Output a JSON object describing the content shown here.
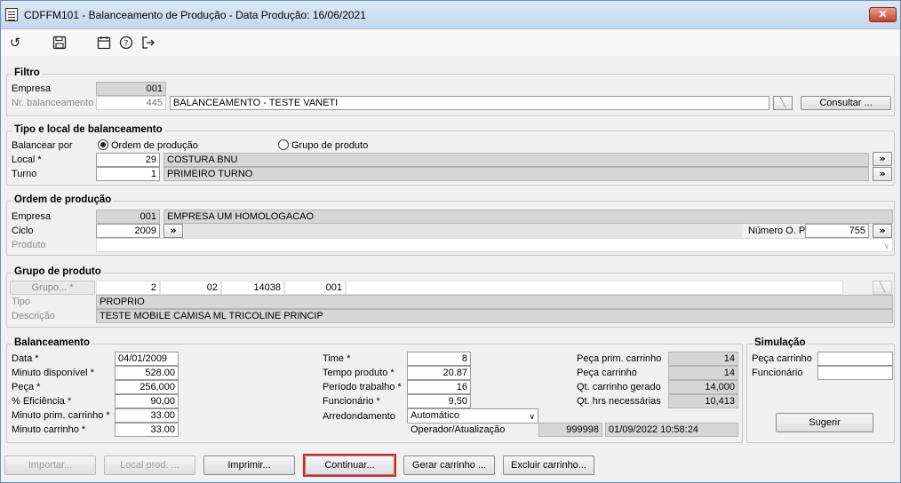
{
  "window": {
    "title": "CDFFM101 - Balanceamento de Produção - Data Produção:  16/06/2021",
    "close_label": "✕"
  },
  "toolbar": {
    "icons": [
      "undo-icon",
      "save-icon",
      "calendar-icon",
      "help-icon",
      "exit-icon"
    ]
  },
  "filtro": {
    "title": "Filtro",
    "empresa_label": "Empresa",
    "empresa_value": "001",
    "nr_label": "Nr. balanceamento",
    "nr_value": "445",
    "nr_desc": "BALANCEAMENTO - TESTE VANETI",
    "consultar_label": "Consultar ..."
  },
  "tipo_local": {
    "title": "Tipo e local de balanceamento",
    "balancear_label": "Balancear por",
    "radio_op": "Ordem de produção",
    "radio_grupo": "Grupo de produto",
    "local_label": "Local *",
    "local_value": "29",
    "local_desc": "COSTURA BNU",
    "turno_label": "Turno",
    "turno_value": "1",
    "turno_desc": "PRIMEIRO TURNO"
  },
  "ordem": {
    "title": "Ordem de produção",
    "empresa_label": "Empresa",
    "empresa_value": "001",
    "empresa_desc": "EMPRESA UM HOMOLOGACAO",
    "ciclo_label": "Ciclo",
    "ciclo_value": "2009",
    "numero_label": "Número O. P.",
    "numero_value": "755",
    "produto_label": "Produto"
  },
  "grupo": {
    "title": "Grupo de produto",
    "grupo_label": "Grupo... *",
    "g1": "2",
    "g2": "02",
    "g3": "14038",
    "g4": "001",
    "tipo_label": "Tipo",
    "tipo_value": "PROPRIO",
    "descricao_label": "Descrição",
    "descricao_value": "TESTE MOBILE CAMISA ML TRICOLINE PRINCIP"
  },
  "balanceamento": {
    "title": "Balanceamento",
    "data_label": "Data *",
    "data_value": "04/01/2009",
    "minuto_disp_label": "Minuto disponível *",
    "minuto_disp_value": "528.00",
    "peca_label": "Peça *",
    "peca_value": "256,000",
    "eficiencia_label": "% Eficiência *",
    "eficiencia_value": "90,00",
    "minuto_prim_label": "Minuto prim. carrinho *",
    "minuto_prim_value": "33.00",
    "minuto_carr_label": "Minuto carrinho *",
    "minuto_carr_value": "33.00",
    "time_label": "Time *",
    "time_value": "8",
    "tempo_label": "Tempo produto *",
    "tempo_value": "20.87",
    "periodo_label": "Período trabalho *",
    "periodo_value": "16",
    "funcionario_label": "Funcionário *",
    "funcionario_value": "9,50",
    "arred_label": "Arredondamento",
    "arred_value": "Automático",
    "operador_label": "Operador/Atualização",
    "operador_value": "999998",
    "atualizacao_value": "01/09/2022 10:58:24",
    "peca_prim_label": "Peça prim. carrinho",
    "peca_prim_value": "14",
    "peca_carr_label": "Peça carrinho",
    "peca_carr_value": "14",
    "qt_carr_label": "Qt. carrinho gerado",
    "qt_carr_value": "14,000",
    "qt_hrs_label": "Qt. hrs necessárias",
    "qt_hrs_value": "10,413"
  },
  "simulacao": {
    "title": "Simulação",
    "peca_label": "Peça carrinho",
    "funcionario_label": "Funcionário",
    "sugerir_label": "Sugerir"
  },
  "buttons": {
    "importar": "Importar...",
    "local_prod": "Local prod. ...",
    "imprimir": "Imprimir...",
    "continuar": "Continuar...",
    "gerar": "Gerar carrinho ...",
    "excluir": "Excluir carrinho..."
  }
}
